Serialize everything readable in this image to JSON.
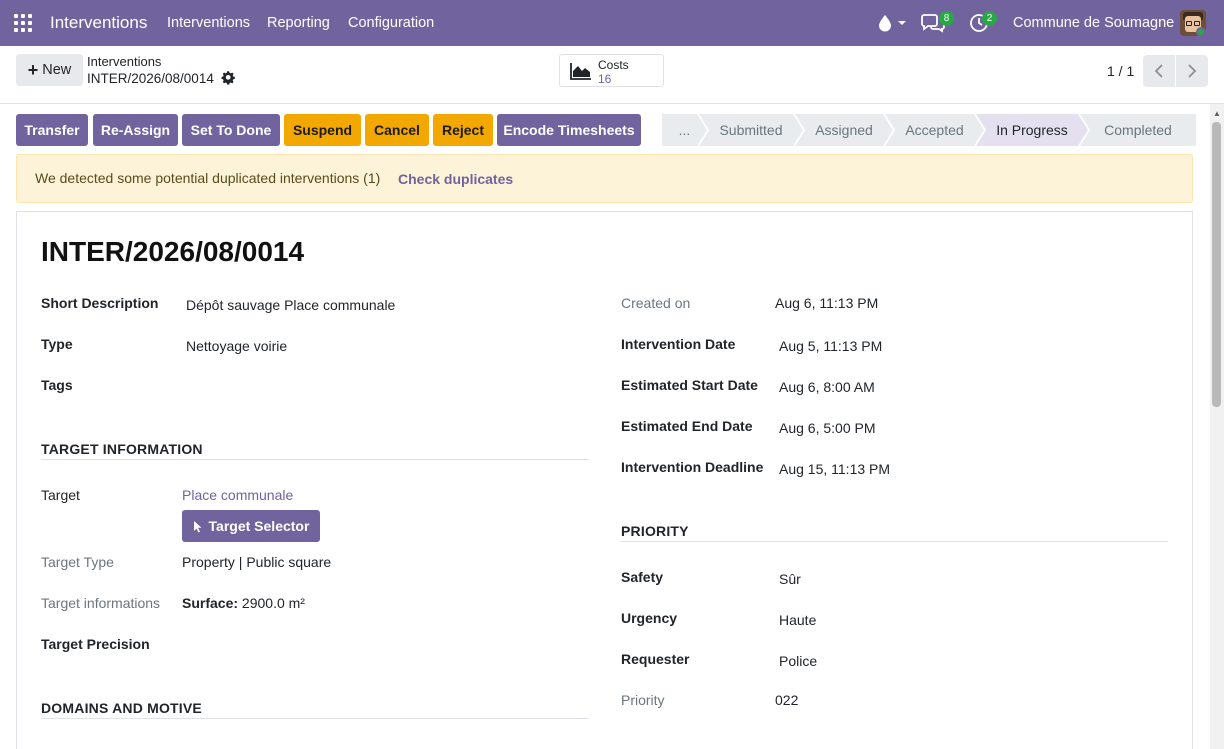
{
  "navbar": {
    "app_title": "Interventions",
    "menu": [
      "Interventions",
      "Reporting",
      "Configuration"
    ],
    "chat_badge": "8",
    "activity_badge": "2",
    "company": "Commune de Soumagne"
  },
  "control": {
    "new_label": "New",
    "breadcrumb_parent": "Interventions",
    "breadcrumb_current": "INTER/2026/08/0014",
    "costs_label": "Costs",
    "costs_value": "16",
    "pager": "1 / 1"
  },
  "actions": {
    "transfer": "Transfer",
    "reassign": "Re-Assign",
    "set_done": "Set To Done",
    "suspend": "Suspend",
    "cancel": "Cancel",
    "reject": "Reject",
    "encode": "Encode Timesheets"
  },
  "stages": [
    "...",
    "Submitted",
    "Assigned",
    "Accepted",
    "In Progress",
    "Completed"
  ],
  "alert": {
    "message": "We detected some potential duplicated interventions (1)",
    "link": "Check duplicates"
  },
  "record": {
    "title": "INTER/2026/08/0014",
    "short_description_label": "Short Description",
    "short_description": "Dépôt sauvage Place communale",
    "type_label": "Type",
    "type": "Nettoyage voirie",
    "tags_label": "Tags",
    "created_on_label": "Created on",
    "created_on": "Aug 6, 11:13 PM",
    "intervention_date_label": "Intervention Date",
    "intervention_date": "Aug 5, 11:13 PM",
    "est_start_label": "Estimated Start Date",
    "est_start": "Aug 6, 8:00 AM",
    "est_end_label": "Estimated End Date",
    "est_end": "Aug 6, 5:00 PM",
    "deadline_label": "Intervention Deadline",
    "deadline": "Aug 15, 11:13 PM",
    "target_section": "TARGET INFORMATION",
    "target_label": "Target",
    "target": "Place communale",
    "target_selector": "Target Selector",
    "target_type_label": "Target Type",
    "target_type": "Property | Public square",
    "target_info_label": "Target informations",
    "surface_label": "Surface:",
    "surface_value": "2900.0 m²",
    "target_precision_label": "Target Precision",
    "domains_section": "DOMAINS AND MOTIVE",
    "priority_section": "PRIORITY",
    "safety_label": "Safety",
    "safety": "Sûr",
    "urgency_label": "Urgency",
    "urgency": "Haute",
    "requester_label": "Requester",
    "requester": "Police",
    "priority_label": "Priority",
    "priority": "022"
  }
}
